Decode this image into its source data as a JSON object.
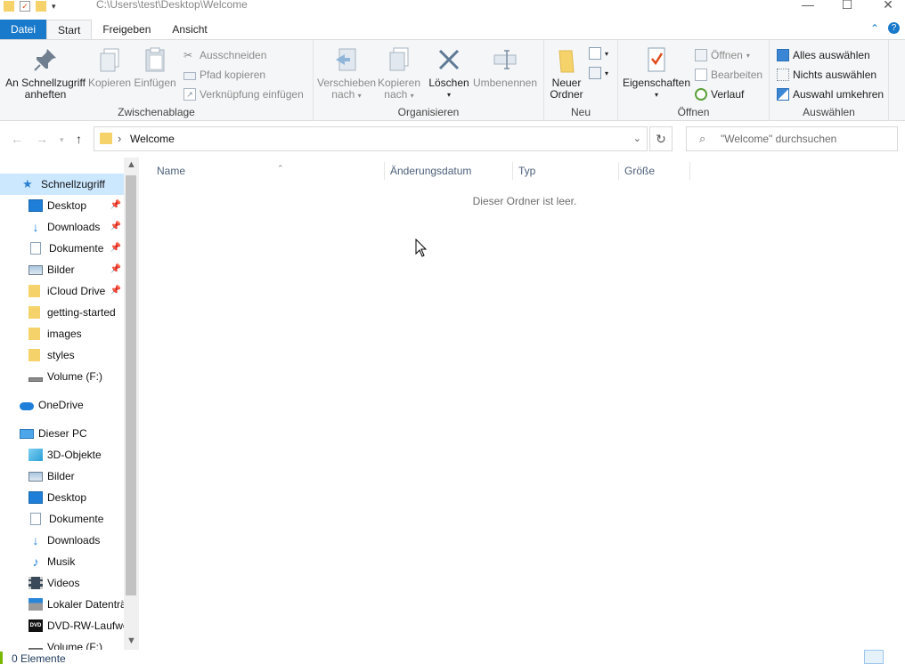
{
  "window": {
    "path": "C:\\Users\\test\\Desktop\\Welcome"
  },
  "tabs": {
    "file": "Datei",
    "start": "Start",
    "share": "Freigeben",
    "view": "Ansicht"
  },
  "ribbon": {
    "clipboard": {
      "label": "Zwischenablage",
      "pin": "An Schnellzugriff anheften",
      "pin_line1": "An Schnellzugriff",
      "pin_line2": "anheften",
      "copy": "Kopieren",
      "paste": "Einfügen",
      "cut": "Ausschneiden",
      "copy_path": "Pfad kopieren",
      "paste_shortcut": "Verknüpfung einfügen"
    },
    "organize": {
      "label": "Organisieren",
      "move_line1": "Verschieben",
      "move_line2": "nach",
      "copyto_line1": "Kopieren",
      "copyto_line2": "nach",
      "delete": "Löschen",
      "rename": "Umbenennen"
    },
    "new": {
      "label": "Neu",
      "folder_line1": "Neuer",
      "folder_line2": "Ordner"
    },
    "open": {
      "label": "Öffnen",
      "properties": "Eigenschaften",
      "open": "Öffnen",
      "edit": "Bearbeiten",
      "history": "Verlauf"
    },
    "select": {
      "label": "Auswählen",
      "select_all": "Alles auswählen",
      "select_none": "Nichts auswählen",
      "invert": "Auswahl umkehren"
    }
  },
  "address": {
    "crumb": "Welcome"
  },
  "search": {
    "placeholder": "\"Welcome\" durchsuchen"
  },
  "sidebar": {
    "quick_access": "Schnellzugriff",
    "quick_items": [
      {
        "label": "Desktop",
        "icon": "desktop-icon",
        "pinned": true
      },
      {
        "label": "Downloads",
        "icon": "download-arrow-icon",
        "pinned": true
      },
      {
        "label": "Dokumente",
        "icon": "document-icon",
        "pinned": true
      },
      {
        "label": "Bilder",
        "icon": "pictures-icon",
        "pinned": true
      },
      {
        "label": "iCloud Drive",
        "icon": "folder-icon",
        "pinned": true
      },
      {
        "label": "getting-started",
        "icon": "folder-icon",
        "pinned": false
      },
      {
        "label": "images",
        "icon": "folder-icon",
        "pinned": false
      },
      {
        "label": "styles",
        "icon": "folder-icon",
        "pinned": false
      },
      {
        "label": "Volume (F:)",
        "icon": "drive-icon",
        "pinned": false
      }
    ],
    "onedrive": "OneDrive",
    "this_pc": "Dieser PC",
    "pc_items": [
      {
        "label": "3D-Objekte",
        "icon": "cube-icon"
      },
      {
        "label": "Bilder",
        "icon": "pictures-icon"
      },
      {
        "label": "Desktop",
        "icon": "desktop-icon"
      },
      {
        "label": "Dokumente",
        "icon": "document-icon"
      },
      {
        "label": "Downloads",
        "icon": "download-arrow-icon"
      },
      {
        "label": "Musik",
        "icon": "music-note-icon"
      },
      {
        "label": "Videos",
        "icon": "film-icon"
      },
      {
        "label": "Lokaler Datenträ",
        "icon": "local-disk-icon"
      },
      {
        "label": "DVD-RW-Laufwe",
        "icon": "dvd-icon"
      },
      {
        "label": "Volume (F:)",
        "icon": "drive-icon"
      }
    ]
  },
  "columns": {
    "name": "Name",
    "date": "Änderungsdatum",
    "type": "Typ",
    "size": "Größe"
  },
  "content": {
    "empty_message": "Dieser Ordner ist leer."
  },
  "status": {
    "count": "0 Elemente"
  },
  "colors": {
    "accent": "#1979ca",
    "selection": "#cce8ff",
    "folder": "#f6d26b"
  }
}
